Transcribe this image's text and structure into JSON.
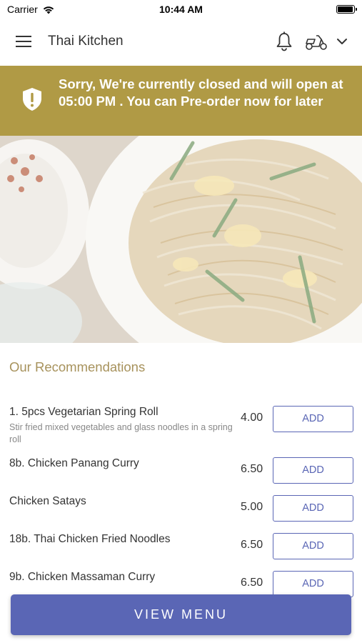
{
  "status_bar": {
    "carrier": "Carrier",
    "time": "10:44 AM",
    "battery_level": 0.95
  },
  "header": {
    "title": "Thai Kitchen"
  },
  "banner": {
    "message": "Sorry, We're currently closed and will open at 05:00 PM . You can Pre-order now for later",
    "color": "#b09a45"
  },
  "recommendations": {
    "title": "Our Recommendations",
    "items": [
      {
        "name": "1. 5pcs Vegetarian Spring Roll",
        "description": "Stir fried mixed vegetables and glass noodles in a spring roll",
        "price": "4.00",
        "add_label": "ADD"
      },
      {
        "name": "8b. Chicken Panang Curry",
        "description": "",
        "price": "6.50",
        "add_label": "ADD"
      },
      {
        "name": "Chicken Satays",
        "description": "",
        "price": "5.00",
        "add_label": "ADD"
      },
      {
        "name": "18b. Thai Chicken Fried Noodles",
        "description": "",
        "price": "6.50",
        "add_label": "ADD"
      },
      {
        "name": "9b. Chicken Massaman Curry",
        "description": "",
        "price": "6.50",
        "add_label": "ADD"
      }
    ]
  },
  "footer": {
    "view_menu_label": "VIEW MENU",
    "accent": "#5a66b5"
  }
}
